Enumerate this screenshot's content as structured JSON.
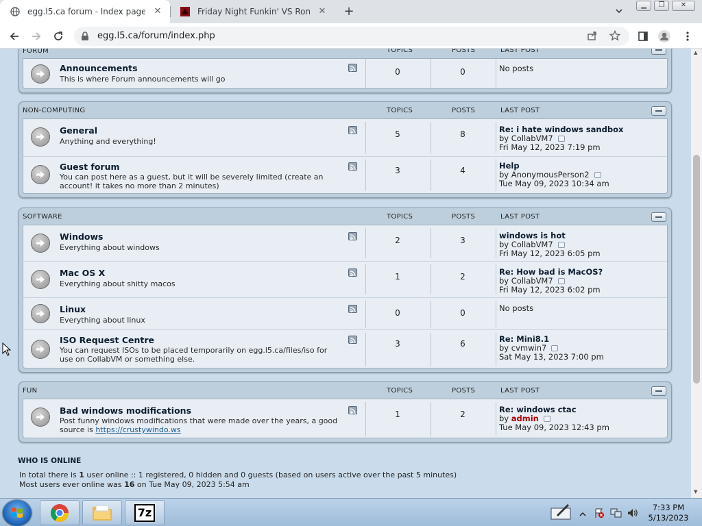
{
  "browser": {
    "tabs": [
      {
        "title": "egg.l5.ca forum - Index page",
        "active": true,
        "favicon": "globe-icon"
      },
      {
        "title": "Friday Night Funkin' VS Ronnie M",
        "active": false,
        "favicon": "game-favicon-icon"
      }
    ],
    "url": "egg.l5.ca/forum/index.php"
  },
  "forum": {
    "categories": [
      {
        "name": "FORUM",
        "col_topics": "TOPICS",
        "col_posts": "POSTS",
        "col_last": "LAST POST",
        "forums": [
          {
            "name": "Announcements",
            "desc": "This is where Forum announcements will go",
            "topics": "0",
            "posts": "0",
            "last_none": "No posts"
          }
        ]
      },
      {
        "name": "NON-COMPUTING",
        "col_topics": "TOPICS",
        "col_posts": "POSTS",
        "col_last": "LAST POST",
        "forums": [
          {
            "name": "General",
            "desc": "Anything and everything!",
            "topics": "5",
            "posts": "8",
            "last_title": "Re: i hate windows sandbox",
            "last_by": "by",
            "last_user": "CollabVM7",
            "last_date": "Fri May 12, 2023 7:19 pm"
          },
          {
            "name": "Guest forum",
            "desc": "You can post here as a guest, but it will be severely limited (create an account! it takes no more than 2 minutes)",
            "topics": "3",
            "posts": "4",
            "last_title": "Help",
            "last_by": "by",
            "last_user": "AnonymousPerson2",
            "last_date": "Tue May 09, 2023 10:34 am"
          }
        ]
      },
      {
        "name": "SOFTWARE",
        "col_topics": "TOPICS",
        "col_posts": "POSTS",
        "col_last": "LAST POST",
        "forums": [
          {
            "name": "Windows",
            "desc": "Everything about windows",
            "topics": "2",
            "posts": "3",
            "last_title": "windows is hot",
            "last_by": "by",
            "last_user": "CollabVM7",
            "last_date": "Fri May 12, 2023 6:05 pm"
          },
          {
            "name": "Mac OS X",
            "desc": "Everything about shitty macos",
            "topics": "1",
            "posts": "2",
            "last_title": "Re: How bad is MacOS?",
            "last_by": "by",
            "last_user": "CollabVM7",
            "last_date": "Fri May 12, 2023 6:02 pm"
          },
          {
            "name": "Linux",
            "desc": "Everything about linux",
            "topics": "0",
            "posts": "0",
            "last_none": "No posts"
          },
          {
            "name": "ISO Request Centre",
            "desc": "You can request ISOs to be placed temporarily on egg.l5.ca/files/iso for use on CollabVM or something else.",
            "topics": "3",
            "posts": "6",
            "last_title": "Re: Mini8.1",
            "last_by": "by",
            "last_user": "cvmwin7",
            "last_date": "Sat May 13, 2023 7:00 pm"
          }
        ]
      },
      {
        "name": "FUN",
        "col_topics": "TOPICS",
        "col_posts": "POSTS",
        "col_last": "LAST POST",
        "forums": [
          {
            "name": "Bad windows modifications",
            "desc": "Post funny windows modifications that were made over the years, a good source is",
            "desc_link": "https://crustywindo.ws",
            "topics": "1",
            "posts": "2",
            "last_title": "Re: windows ctac",
            "last_by": "by",
            "last_user": "admin",
            "last_date": "Tue May 09, 2023 12:43 pm"
          }
        ]
      }
    ],
    "who_online": {
      "heading": "WHO IS ONLINE",
      "l1_a": "In total there is ",
      "l1_count": "1",
      "l1_b": " user online :: 1 registered, 0 hidden and 0 guests (based on users active over the past 5 minutes)",
      "l2_a": "Most users ever online was ",
      "l2_count": "16",
      "l2_b": " on Tue May 09, 2023 5:54 am"
    }
  },
  "taskbar": {
    "time": "7:33 PM",
    "date": "5/13/2023",
    "apps": [
      "chrome-icon",
      "file-explorer-icon",
      "7zip-icon"
    ],
    "app_7zip_label": "7z"
  }
}
